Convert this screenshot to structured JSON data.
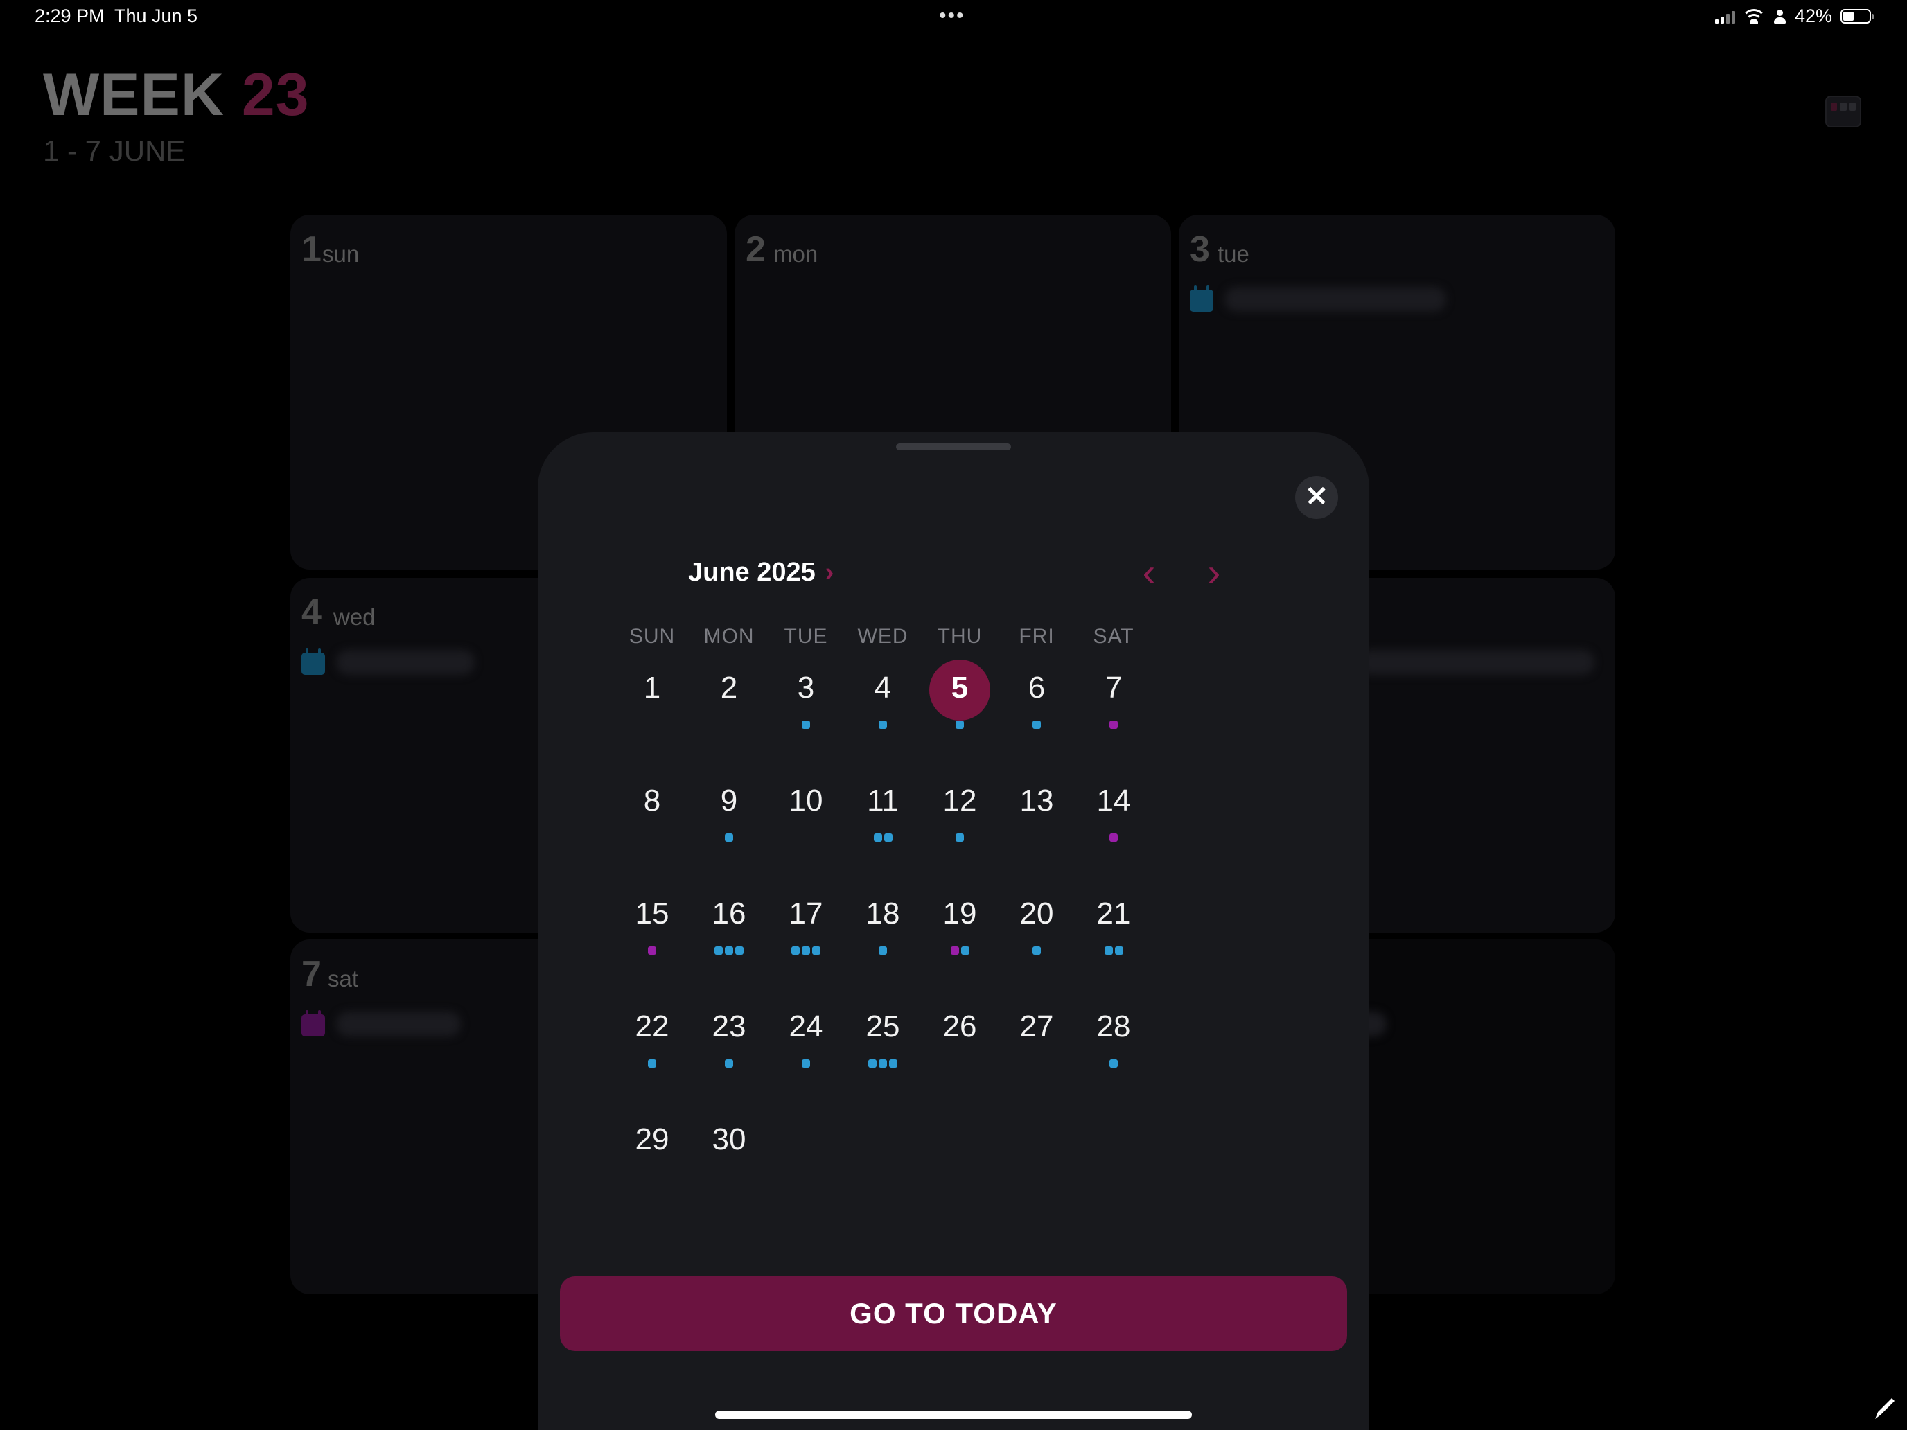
{
  "status_bar": {
    "time": "2:29 PM",
    "date": "Thu Jun 5",
    "more": "•••",
    "battery": "42%",
    "battery_level": 0.42
  },
  "week_view": {
    "title_prefix": "WEEK",
    "title_number": "23",
    "range": "1 - 7 JUNE",
    "days": [
      {
        "num": "1",
        "name": "sun"
      },
      {
        "num": "2",
        "name": "mon"
      },
      {
        "num": "3",
        "name": "tue"
      },
      {
        "num": "4",
        "name": "wed"
      },
      {
        "num": "7",
        "name": "sat"
      }
    ]
  },
  "calendar": {
    "month_title": "June 2025",
    "weekdays": [
      "SUN",
      "MON",
      "TUE",
      "WED",
      "THU",
      "FRI",
      "SAT"
    ],
    "today": 5,
    "first_weekday_index": 0,
    "days_in_month": 30,
    "event_colors": {
      "b": "#2d9bd3",
      "p": "#9a1fa8"
    },
    "events": {
      "3": "b",
      "4": "b",
      "5": "b",
      "6": "b",
      "7": "p",
      "9": "b",
      "11": "bb",
      "12": "b",
      "14": "p",
      "15": "p",
      "16": "bbb",
      "17": "bbb",
      "18": "b",
      "19": "pb",
      "20": "b",
      "21": "bb",
      "22": "b",
      "23": "b",
      "24": "b",
      "25": "bbb",
      "28": "b"
    }
  },
  "actions": {
    "go_to_today": "GO TO TODAY"
  },
  "colors": {
    "accent": "#7a1540",
    "button": "#6b1340",
    "sheet": "#18191d"
  }
}
